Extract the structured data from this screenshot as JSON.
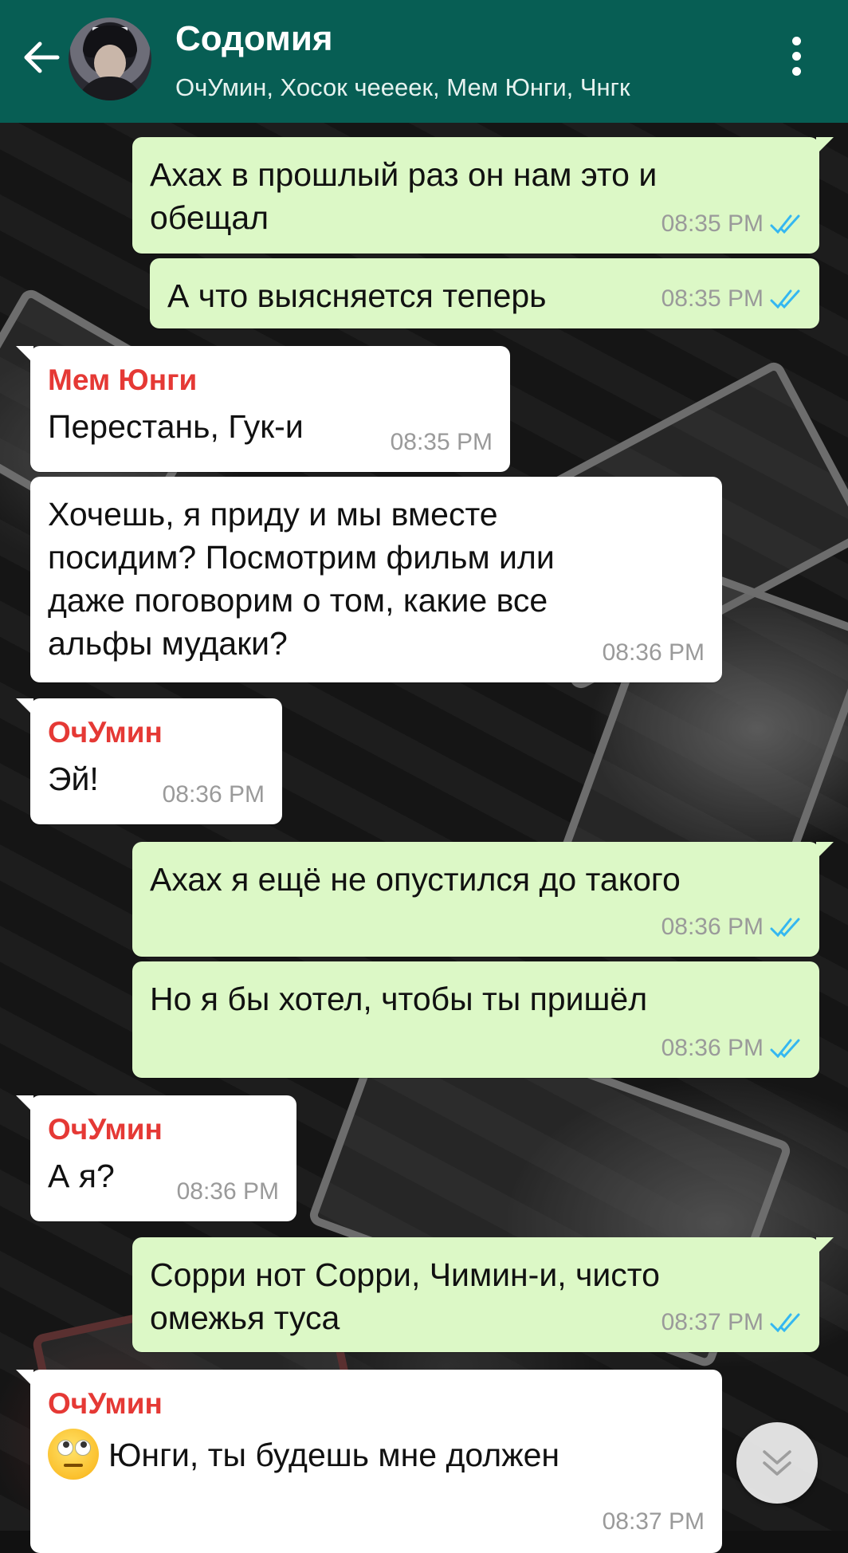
{
  "header": {
    "back_icon": "arrow-left-icon",
    "title": "Содомия",
    "members": "ОчУмин, Хосок чееeек, Мем Юнги, Чнгк",
    "menu_icon": "more-vertical-icon",
    "color": "#075e54"
  },
  "messages": [
    {
      "direction": "out",
      "text_lines": [
        "Ахах в прошлый раз он нам это и",
        "обещал"
      ],
      "time": "08:35 PM",
      "status": "read"
    },
    {
      "direction": "out",
      "text_lines": [
        "А что выясняется теперь"
      ],
      "time": "08:35 PM",
      "status": "read"
    },
    {
      "direction": "in",
      "sender": "Мем Юнги",
      "text_lines": [
        "Перестань, Гук-и"
      ],
      "time": "08:35 PM"
    },
    {
      "direction": "in",
      "text_lines": [
        "Хочешь, я приду и мы вместе",
        "посидим? Посмотрим фильм или",
        "даже поговорим о том, какие все",
        "альфы мудаки?"
      ],
      "time": "08:36 PM"
    },
    {
      "direction": "in",
      "sender": "ОчУмин",
      "text_lines": [
        "Эй!"
      ],
      "time": "08:36 PM"
    },
    {
      "direction": "out",
      "text_lines": [
        "Ахах я ещё не опустился до такого"
      ],
      "time": "08:36 PM",
      "status": "read"
    },
    {
      "direction": "out",
      "text_lines": [
        "Но я бы хотел, чтобы ты пришёл"
      ],
      "time": "08:36 PM",
      "status": "read"
    },
    {
      "direction": "in",
      "sender": "ОчУмин",
      "text_lines": [
        "А я?"
      ],
      "time": "08:36 PM"
    },
    {
      "direction": "out",
      "text_lines": [
        "Сорри нот Сорри, Чимин-и, чисто",
        "омежья туса"
      ],
      "time": "08:37 PM",
      "status": "read"
    },
    {
      "direction": "in",
      "sender": "ОчУмин",
      "emoji": "face-with-rolling-eyes-icon",
      "text_lines": [
        "Юнги, ты будешь мне должен"
      ],
      "time": "08:37 PM"
    }
  ],
  "scroll_down_icon": "double-chevron-down-icon",
  "colors": {
    "outgoing_bubble": "#dcf8c6",
    "incoming_bubble": "#ffffff",
    "sender_name": "#e53935",
    "read_ticks": "#34b7f1"
  }
}
